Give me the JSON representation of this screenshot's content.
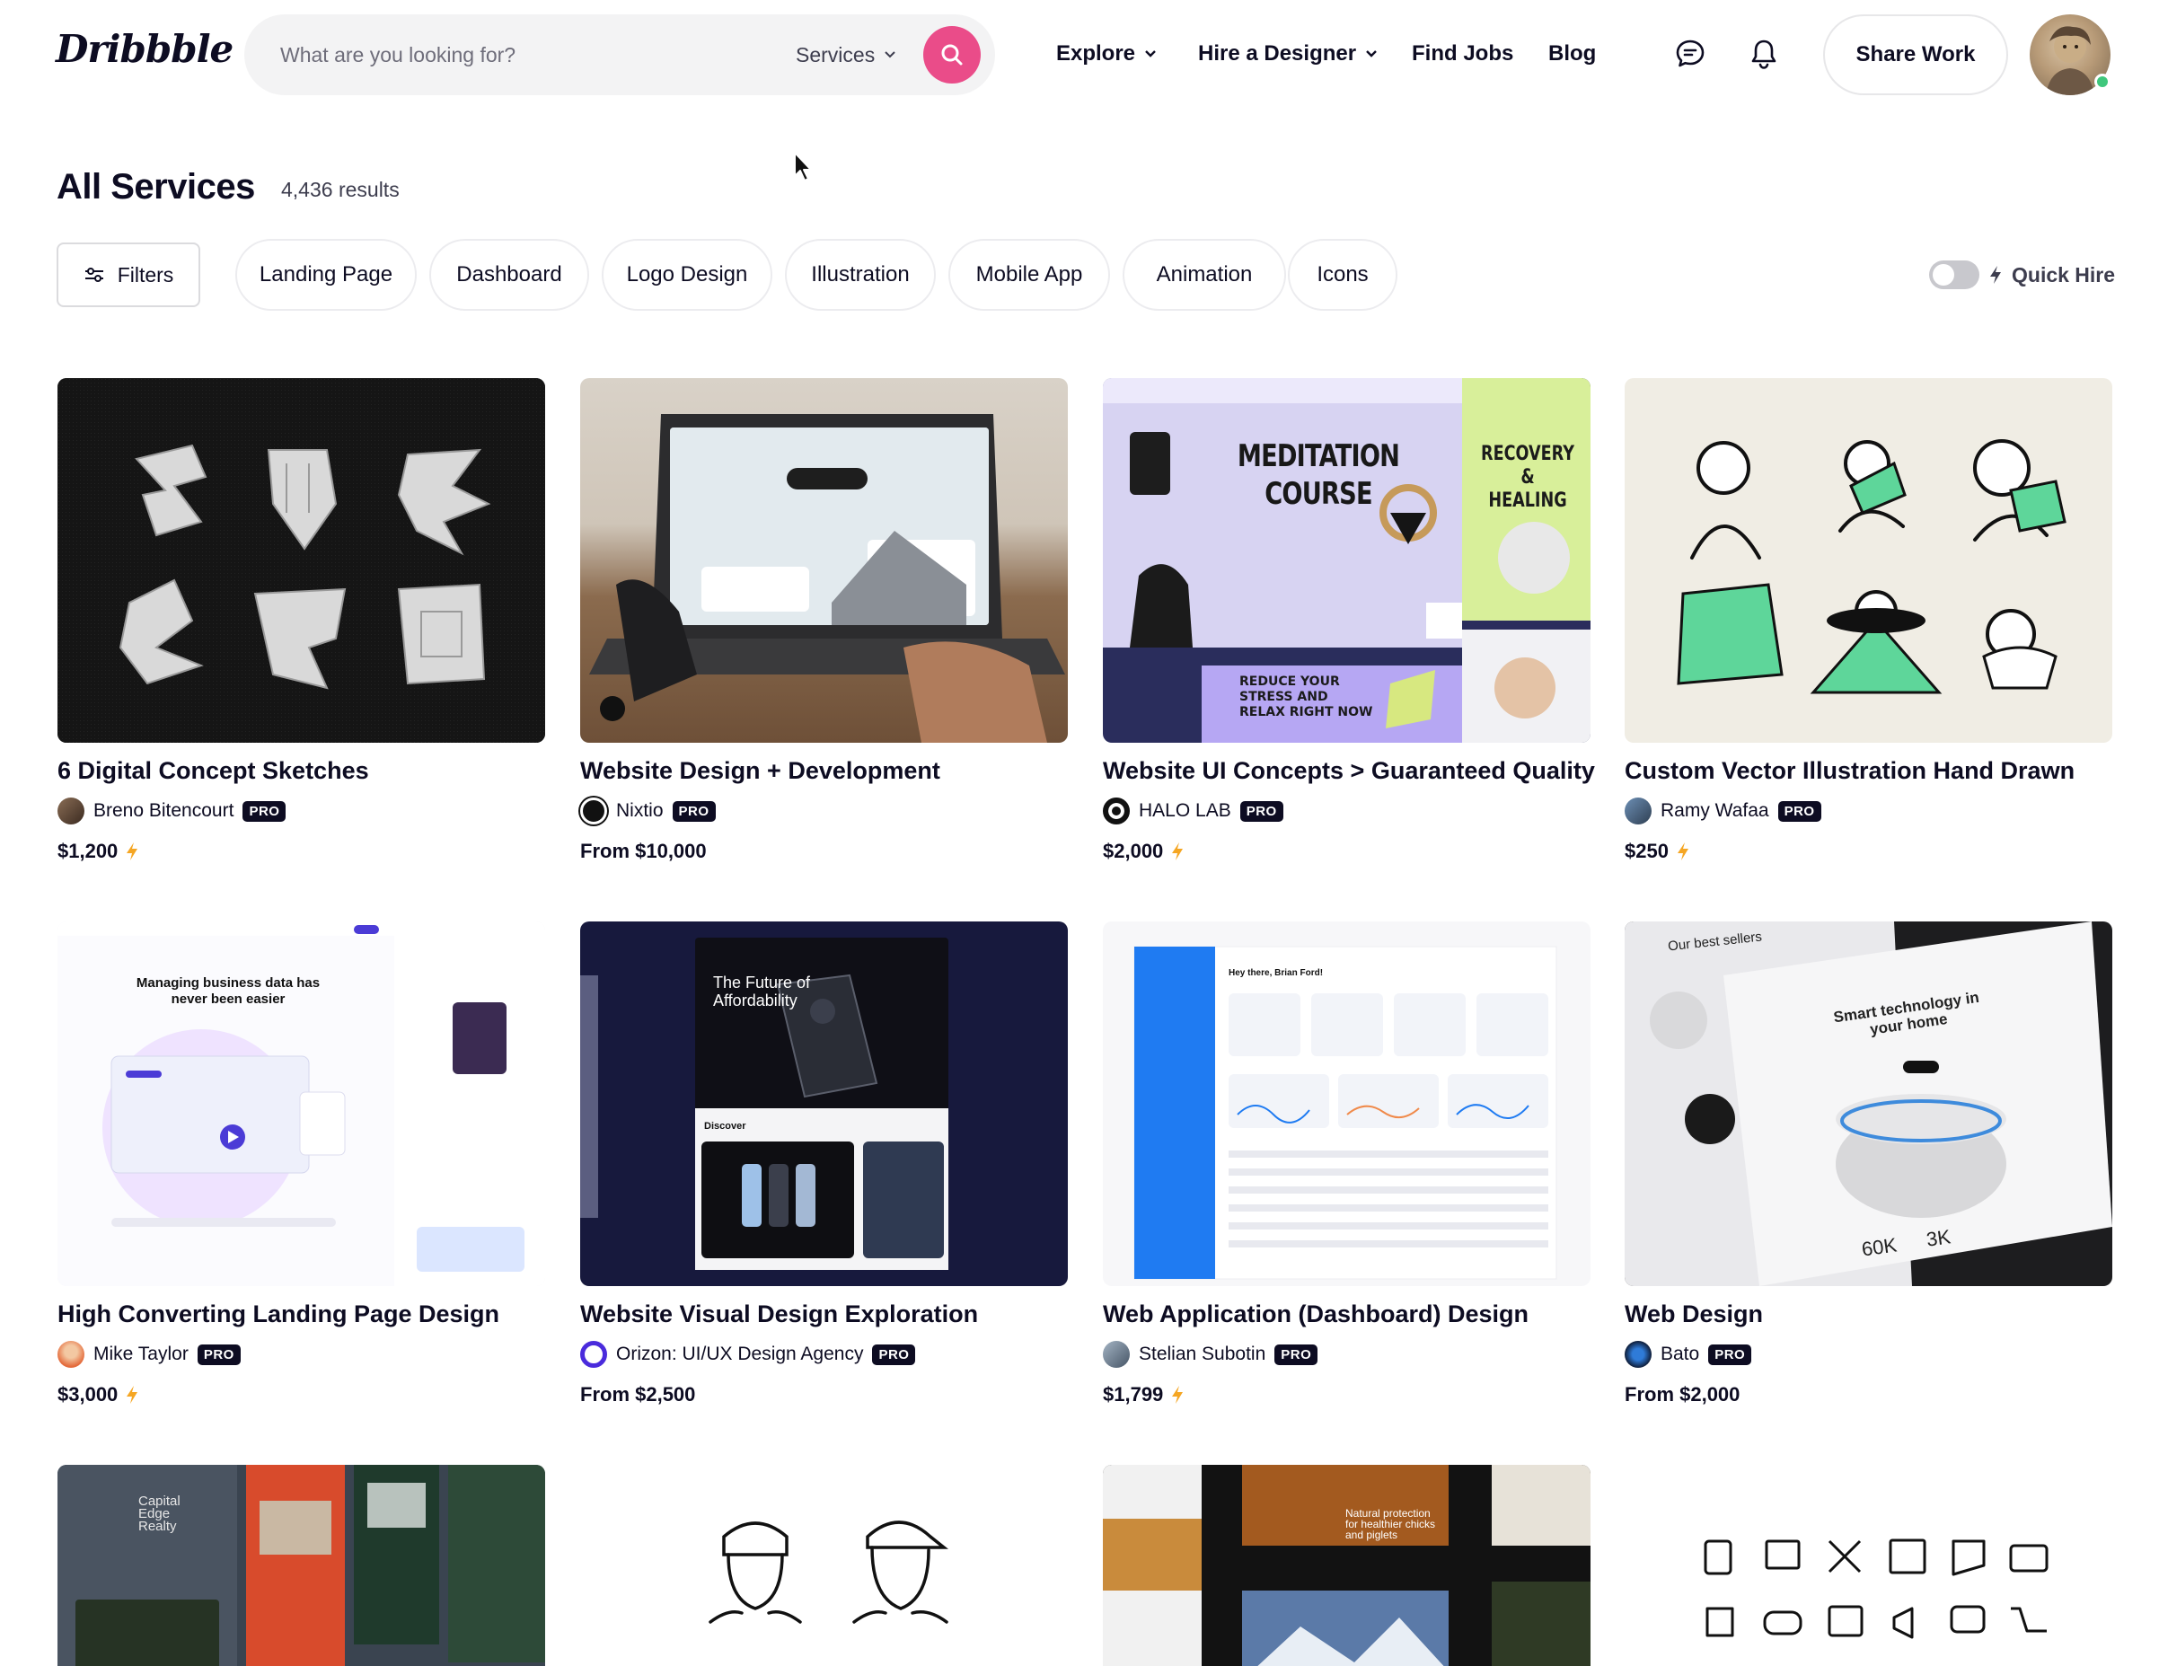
{
  "header": {
    "logo": "Dribbble",
    "search_placeholder": "What are you looking for?",
    "search_scope": "Services",
    "nav": [
      {
        "label": "Explore"
      },
      {
        "label": "Hire a Designer"
      },
      {
        "label": "Find Jobs"
      },
      {
        "label": "Blog"
      }
    ],
    "share_label": "Share Work"
  },
  "page": {
    "title": "All Services",
    "results": "4,436 results"
  },
  "filters": {
    "filters_label": "Filters",
    "chips": [
      "Landing Page",
      "Dashboard",
      "Logo Design",
      "Illustration",
      "Mobile App",
      "Animation",
      "Icons"
    ],
    "quick_hire_label": "Quick Hire",
    "quick_hire_on": false
  },
  "cards": [
    {
      "title": "6 Digital Concept Sketches",
      "author": "Breno Bitencourt",
      "pro": "PRO",
      "price": "$1,200",
      "fast": true
    },
    {
      "title": "Website Design + Development",
      "author": "Nixtio",
      "pro": "PRO",
      "price": "From $10,000",
      "fast": false
    },
    {
      "title": "Website UI Concepts > Guaranteed Quality",
      "author": "HALO LAB",
      "pro": "PRO",
      "price": "$2,000",
      "fast": true
    },
    {
      "title": "Custom Vector Illustration Hand Drawn",
      "author": "Ramy Wafaa",
      "pro": "PRO",
      "price": "$250",
      "fast": true
    },
    {
      "title": "High Converting Landing Page Design",
      "author": "Mike Taylor",
      "pro": "PRO",
      "price": "$3,000",
      "fast": true
    },
    {
      "title": "Website Visual Design Exploration",
      "author": "Orizon: UI/UX Design Agency",
      "pro": "PRO",
      "price": "From $2,500",
      "fast": false
    },
    {
      "title": "Web Application (Dashboard) Design",
      "author": "Stelian Subotin",
      "pro": "PRO",
      "price": "$1,799",
      "fast": true
    },
    {
      "title": "Web Design",
      "author": "Bato",
      "pro": "PRO",
      "price": "From $2,000",
      "fast": false
    }
  ],
  "thumb_text": {
    "meditation_title": "MEDITATION COURSE",
    "recovery": "RECOVERY & HEALING",
    "reduce_stress": "REDUCE YOUR STRESS AND RELAX RIGHT NOW",
    "landing_headline": "Managing business data has never been easier",
    "phone_headline": "The Future of Affordability",
    "phone_discover": "Discover",
    "dash_greeting": "Hey there, Brian Ford!",
    "smart_home": "Smart technology in your home",
    "best_sellers": "Our best sellers",
    "stat_60k": "60K",
    "stat_3k": "3K",
    "realty": "Capital Edge Realty",
    "natural": "Natural protection for healthier chicks and piglets"
  },
  "colors": {
    "brand_pink": "#ea4c89",
    "ink": "#0d0c22",
    "bolt": "#f5a623",
    "online": "#3fc77c"
  }
}
